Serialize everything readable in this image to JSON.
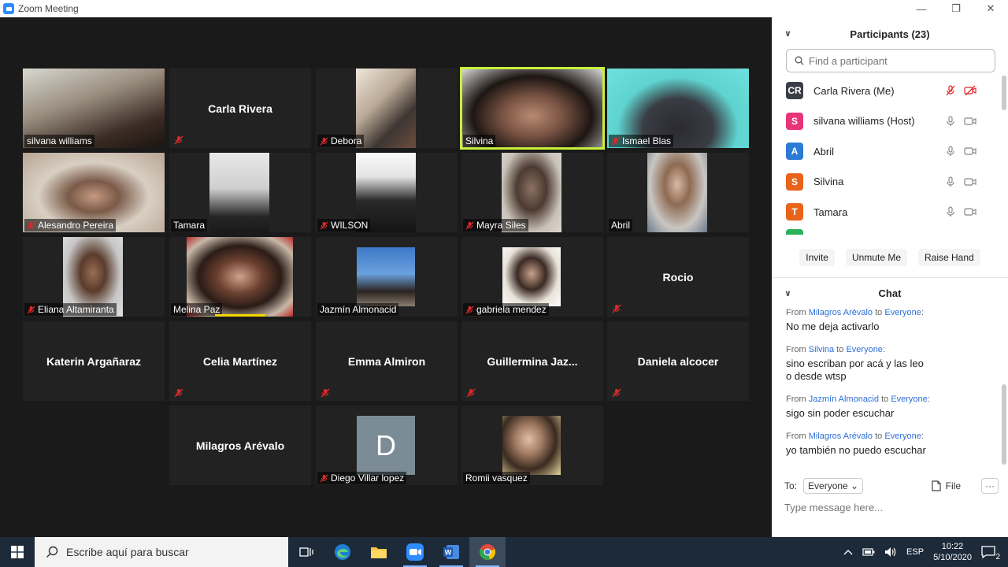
{
  "window": {
    "title": "Zoom Meeting"
  },
  "tiles": [
    {
      "name": "silvana williams",
      "muted": false
    },
    {
      "name": "Carla Rivera",
      "muted": true
    },
    {
      "name": "Debora",
      "muted": true
    },
    {
      "name": "Silvina",
      "muted": false
    },
    {
      "name": "Ismael Blas",
      "muted": true
    },
    {
      "name": "Alesandro Pereira",
      "muted": true
    },
    {
      "name": "Tamara",
      "muted": false
    },
    {
      "name": "WILSON",
      "muted": true
    },
    {
      "name": "Mayra Siles",
      "muted": true
    },
    {
      "name": "Abril",
      "muted": false
    },
    {
      "name": "Eliana Altamiranta",
      "muted": true
    },
    {
      "name": "Melina Paz",
      "muted": false
    },
    {
      "name": "Jazmín Almonacid",
      "muted": false
    },
    {
      "name": "gabriela mendez",
      "muted": true
    },
    {
      "name": "Rocio",
      "muted": true
    },
    {
      "name": "Katerin Argañaraz",
      "muted": false
    },
    {
      "name": "Celia Martínez",
      "muted": true
    },
    {
      "name": "Emma Almiron",
      "muted": true
    },
    {
      "name": "Guillermina  Jaz...",
      "muted": true
    },
    {
      "name": "Daniela alcocer",
      "muted": true
    },
    {
      "name": "Milagros Arévalo",
      "muted": false
    },
    {
      "name": "Diego Villar lopez",
      "muted": true,
      "initial": "D"
    },
    {
      "name": "Romii vasquez",
      "muted": false
    }
  ],
  "participants": {
    "title": "Participants (23)",
    "search_placeholder": "Find a participant",
    "list": [
      {
        "initials": "CR",
        "name": "Carla Rivera (Me)",
        "color": "#3a3f47",
        "muted": true,
        "video_off": true
      },
      {
        "initials": "S",
        "name": "silvana williams (Host)",
        "color": "#e8357a",
        "muted": false,
        "video_off": false
      },
      {
        "initials": "A",
        "name": "Abril",
        "color": "#2b7bd4",
        "muted": false,
        "video_off": false
      },
      {
        "initials": "S",
        "name": "Silvina",
        "color": "#e8641b",
        "muted": false,
        "video_off": false
      },
      {
        "initials": "T",
        "name": "Tamara",
        "color": "#e8641b",
        "muted": false,
        "video_off": false
      }
    ],
    "actions": {
      "invite": "Invite",
      "unmute": "Unmute Me",
      "raise_hand": "Raise Hand"
    }
  },
  "chat": {
    "title": "Chat",
    "messages": [
      {
        "from_label": "From",
        "from": "Milagros Arévalo",
        "to_label": "to",
        "to": "Everyone",
        "text": "No me deja activarlo"
      },
      {
        "from_label": "From",
        "from": "Silvina",
        "to_label": "to",
        "to": "Everyone",
        "text": "sino escriban por acá y las leo\no desde wtsp"
      },
      {
        "from_label": "From",
        "from": "Jazmín Almonacid",
        "to_label": "to",
        "to": "Everyone",
        "text": "sigo sin poder escuchar"
      },
      {
        "from_label": "From",
        "from": "Milagros Arévalo",
        "to_label": "to",
        "to": "Everyone",
        "text": "yo también no puedo escuchar"
      }
    ],
    "to_label": "To:",
    "to_value": "Everyone",
    "file_label": "File",
    "more_label": "···",
    "input_placeholder": "Type message here..."
  },
  "taskbar": {
    "search_text": "Escribe aquí para buscar",
    "lang": "ESP",
    "time": "10:22",
    "date": "5/10/2020",
    "notifications": "2"
  },
  "colors": {
    "active_speaker": "#c7f03a",
    "link_blue": "#2d6fd9",
    "mute_red": "#e02828"
  }
}
